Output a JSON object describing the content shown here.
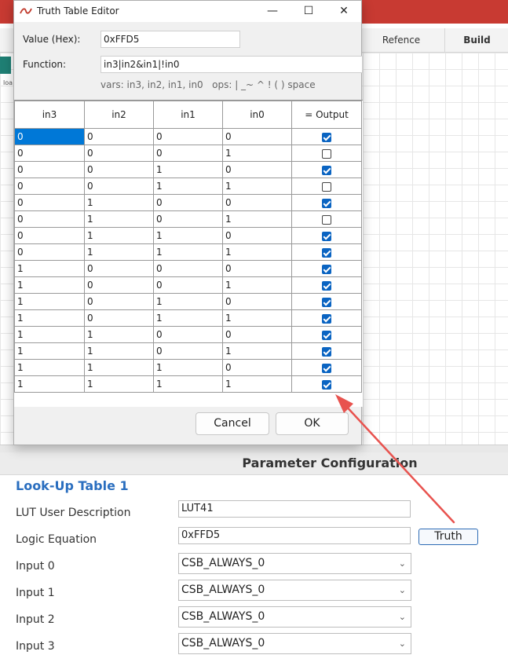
{
  "background": {
    "tabs": [
      {
        "label": "Refence"
      },
      {
        "label": "Build"
      }
    ],
    "side_text": "loa"
  },
  "parameters": {
    "header": "Parameter Configuration",
    "section_title": "Look-Up Table 1",
    "description_label": "LUT User Description",
    "description_value": "LUT41",
    "equation_label": "Logic Equation",
    "equation_value": "0xFFD5",
    "truth_button": "Truth",
    "inputs": [
      {
        "label": "Input 0",
        "value": "CSB_ALWAYS_0"
      },
      {
        "label": "Input 1",
        "value": "CSB_ALWAYS_0"
      },
      {
        "label": "Input 2",
        "value": "CSB_ALWAYS_0"
      },
      {
        "label": "Input 3",
        "value": "CSB_ALWAYS_0"
      }
    ]
  },
  "dialog": {
    "title": "Truth Table Editor",
    "window_buttons": {
      "minimize": "—",
      "maximize": "☐",
      "close": "✕"
    },
    "value_label": "Value (Hex):",
    "value": "0xFFD5",
    "function_label": "Function:",
    "function": "in3|in2&in1|!in0",
    "hint": "vars: in3, in2, in1, in0   ops: | _~ ^ ! ( ) space",
    "columns": [
      "in3",
      "in2",
      "in1",
      "in0",
      "= Output"
    ],
    "rows": [
      {
        "in3": "0",
        "in2": "0",
        "in1": "0",
        "in0": "0",
        "out": true
      },
      {
        "in3": "0",
        "in2": "0",
        "in1": "0",
        "in0": "1",
        "out": false
      },
      {
        "in3": "0",
        "in2": "0",
        "in1": "1",
        "in0": "0",
        "out": true
      },
      {
        "in3": "0",
        "in2": "0",
        "in1": "1",
        "in0": "1",
        "out": false
      },
      {
        "in3": "0",
        "in2": "1",
        "in1": "0",
        "in0": "0",
        "out": true
      },
      {
        "in3": "0",
        "in2": "1",
        "in1": "0",
        "in0": "1",
        "out": false
      },
      {
        "in3": "0",
        "in2": "1",
        "in1": "1",
        "in0": "0",
        "out": true
      },
      {
        "in3": "0",
        "in2": "1",
        "in1": "1",
        "in0": "1",
        "out": true
      },
      {
        "in3": "1",
        "in2": "0",
        "in1": "0",
        "in0": "0",
        "out": true
      },
      {
        "in3": "1",
        "in2": "0",
        "in1": "0",
        "in0": "1",
        "out": true
      },
      {
        "in3": "1",
        "in2": "0",
        "in1": "1",
        "in0": "0",
        "out": true
      },
      {
        "in3": "1",
        "in2": "0",
        "in1": "1",
        "in0": "1",
        "out": true
      },
      {
        "in3": "1",
        "in2": "1",
        "in1": "0",
        "in0": "0",
        "out": true
      },
      {
        "in3": "1",
        "in2": "1",
        "in1": "0",
        "in0": "1",
        "out": true
      },
      {
        "in3": "1",
        "in2": "1",
        "in1": "1",
        "in0": "0",
        "out": true
      },
      {
        "in3": "1",
        "in2": "1",
        "in1": "1",
        "in0": "1",
        "out": true
      }
    ],
    "cancel_label": "Cancel",
    "ok_label": "OK"
  },
  "colors": {
    "accent": "#2a6ebf",
    "selection": "#0078d7",
    "checkbox": "#0a64c2",
    "arrow": "#e8534f",
    "app_bar": "#c83a32"
  }
}
